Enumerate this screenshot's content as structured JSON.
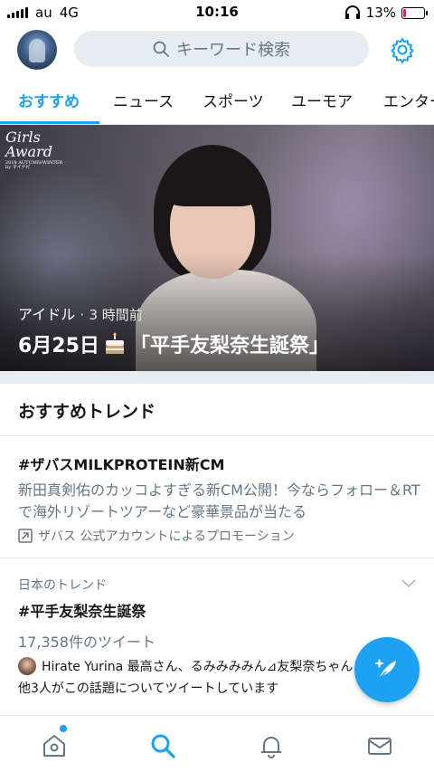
{
  "status_bar": {
    "carrier": "au",
    "network": "4G",
    "time": "10:16",
    "battery": "13%",
    "battery_level": 0.13
  },
  "header": {
    "search_placeholder": "キーワード検索"
  },
  "tabs": [
    {
      "label": "おすすめ",
      "active": true
    },
    {
      "label": "ニュース",
      "active": false
    },
    {
      "label": "スポーツ",
      "active": false
    },
    {
      "label": "ユーモア",
      "active": false
    },
    {
      "label": "エンター",
      "active": false
    }
  ],
  "hero": {
    "logo_line1": "Girls",
    "logo_line2": "Award",
    "logo_line3": "2018 AUTUMN/WINTER by マイナビ",
    "category": "アイドル",
    "separator": "·",
    "time_ago": "3 時間前",
    "title_date": "6月25日",
    "title_main": "「平手友梨奈生誕祭」"
  },
  "section": {
    "title": "おすすめトレンド"
  },
  "promoted": {
    "hashtag": "#ザバスMILKPROTEIN新CM",
    "description": "新田真剣佑のカッコよすぎる新CM公開！今ならフォロー＆RTで海外リゾートツアーなど豪華景品が当たる",
    "promoted_by": "ザバス 公式アカウントによるプロモーション"
  },
  "trend": {
    "context": "日本のトレンド",
    "hashtag": "#平手友梨奈生誕祭",
    "tweet_count": "17,358件のツイート",
    "tweeter_line": "Hirate Yurina 最高さん、るみみみみん⊿友梨奈ちゃん",
    "others_line": "他3人がこの話題についてツイートしています"
  },
  "colors": {
    "accent": "#1da1f2",
    "secondary_text": "#657786",
    "battery_low": "#e0245e"
  },
  "icons": {
    "search": "search-icon",
    "settings": "gear-icon",
    "compose": "compose-feather-icon",
    "home": "home-icon",
    "explore": "search-icon",
    "notifications": "bell-icon",
    "messages": "mail-icon"
  }
}
